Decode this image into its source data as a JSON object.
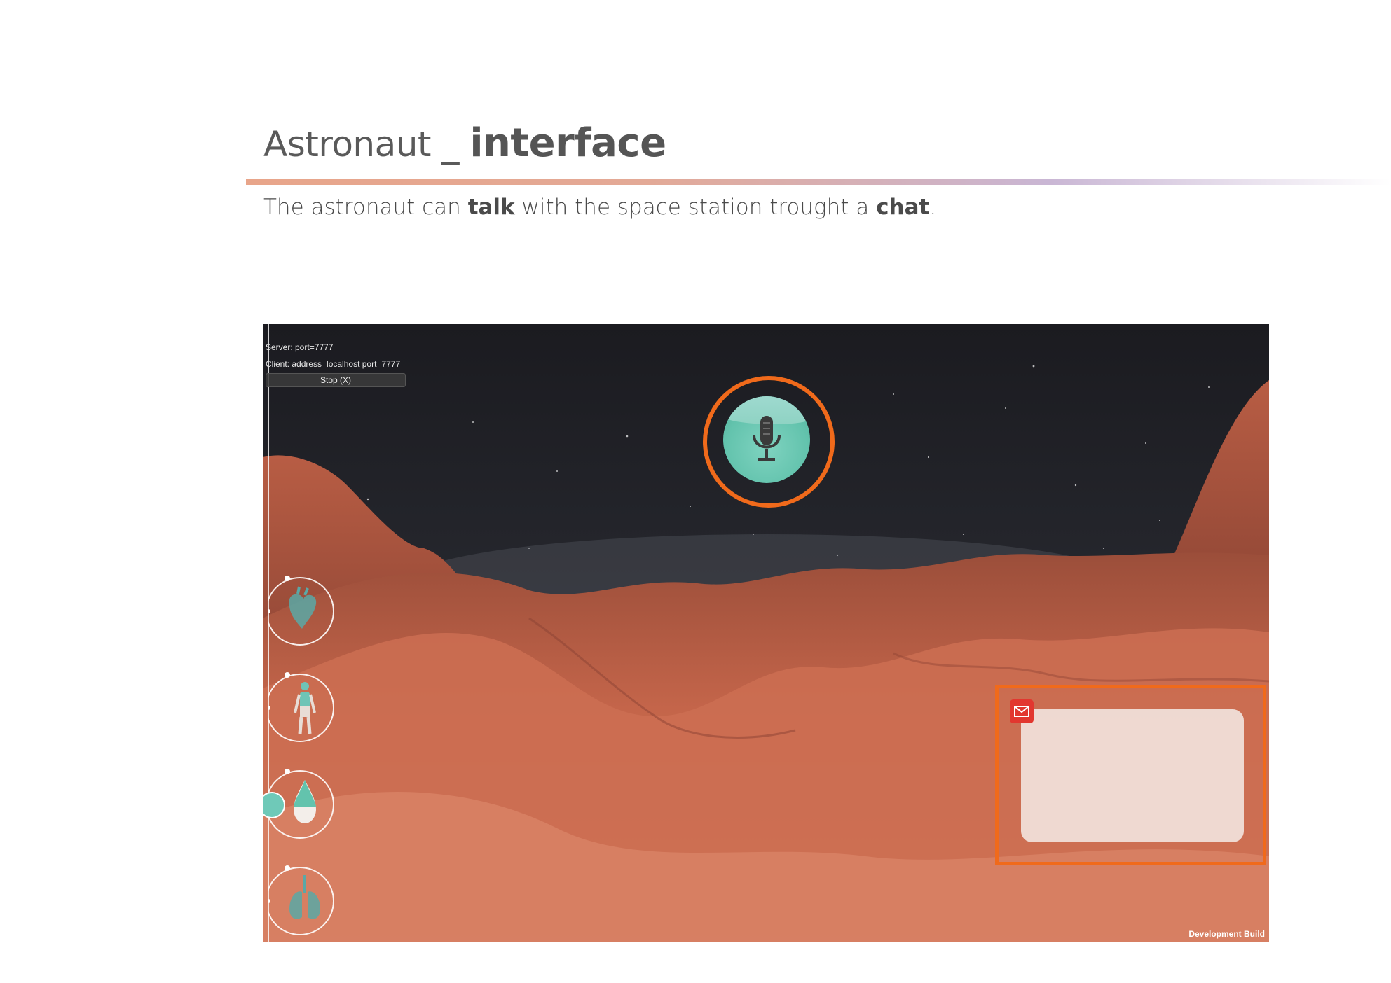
{
  "page": {
    "title_regular": "Astronaut _ ",
    "title_bold": "interface",
    "subtitle_parts": {
      "p1": "The astronaut can ",
      "p2": "talk",
      "p3": " with the space station trought a ",
      "p4": "chat",
      "p5": "."
    }
  },
  "game": {
    "server_label": "Server: port=7777",
    "client_label": "Client: address=localhost port=7777",
    "stop_button": "Stop (X)",
    "dev_build": "Development Build",
    "icons": {
      "mic": "microphone-icon",
      "heart": "heart-icon",
      "body": "body-icon",
      "water": "water-drop-icon",
      "lungs": "lungs-icon",
      "mail": "mail-icon"
    },
    "vitals_levels": {
      "water": 0.35
    },
    "colors": {
      "highlight": "#f06a1b",
      "teal": "#63c3ad",
      "mars": "#c8674b",
      "mail": "#e2372f"
    }
  }
}
